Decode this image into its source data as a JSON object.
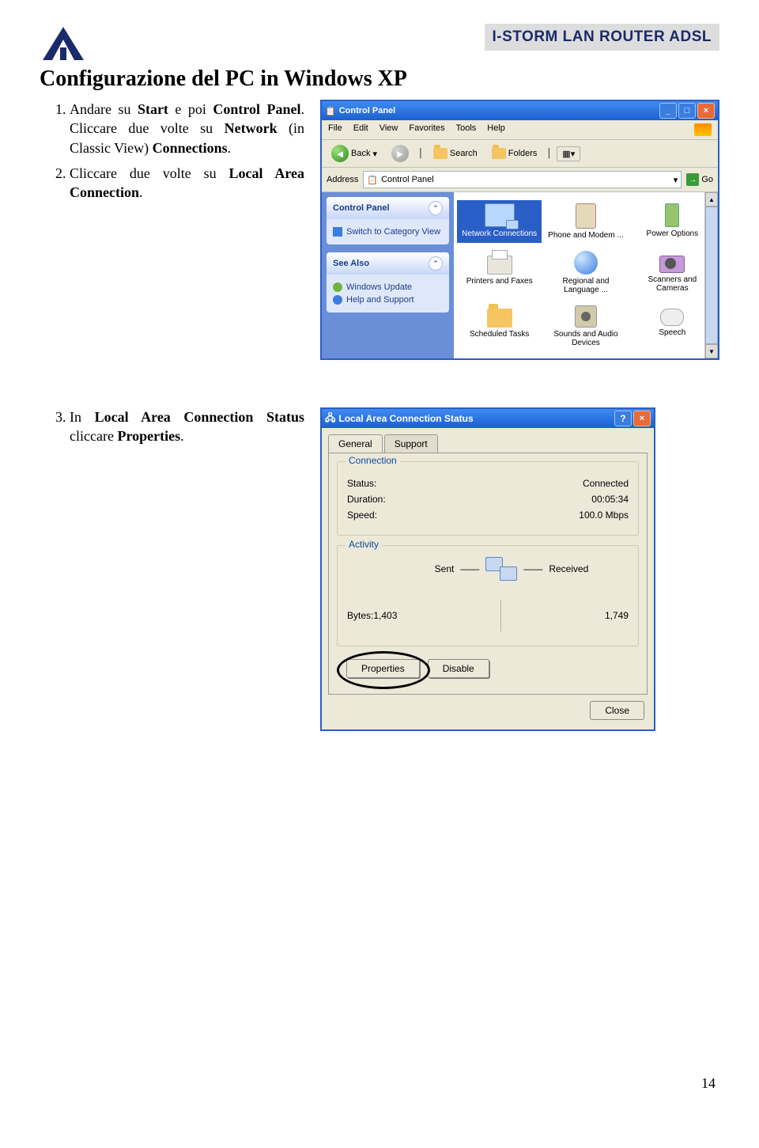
{
  "doc": {
    "header": "I-STORM LAN ROUTER ADSL",
    "title": "Configurazione del  PC in Windows XP",
    "page_number": "14"
  },
  "steps": {
    "s1a": "Andare su ",
    "s1b": "Start",
    "s1c": " e poi ",
    "s1d": "Control Panel",
    "s1e": ". Cliccare due volte su ",
    "s1f": "Network",
    "s1g": " (in Classic View) ",
    "s1h": "Connections",
    "s1i": ".",
    "s2a": "Cliccare due volte su  ",
    "s2b": "Local Area Connection",
    "s2c": ".",
    "s3a": "In ",
    "s3b": "Local Area Connection Status",
    "s3c": " cliccare ",
    "s3d": "Properties",
    "s3e": "."
  },
  "cp": {
    "title": "Control Panel",
    "menu": {
      "file": "File",
      "edit": "Edit",
      "view": "View",
      "fav": "Favorites",
      "tools": "Tools",
      "help": "Help"
    },
    "toolbar": {
      "back": "Back",
      "search": "Search",
      "folders": "Folders"
    },
    "address_label": "Address",
    "address_value": "Control Panel",
    "go": "Go",
    "panel1": {
      "title": "Control Panel",
      "link": "Switch to Category View"
    },
    "panel2": {
      "title": "See Also",
      "link1": "Windows Update",
      "link2": "Help and Support"
    },
    "icons": {
      "i0": "Network Connections",
      "i1": "Phone and Modem ...",
      "i2": "Power Options",
      "i3": "Printers and Faxes",
      "i4": "Regional and Language ...",
      "i5": "Scanners and Cameras",
      "i6": "Scheduled Tasks",
      "i7": "Sounds and Audio Devices",
      "i8": "Speech"
    }
  },
  "status": {
    "title": "Local Area Connection Status",
    "tab_general": "General",
    "tab_support": "Support",
    "group_conn": "Connection",
    "k_status": "Status:",
    "v_status": "Connected",
    "k_dur": "Duration:",
    "v_dur": "00:05:34",
    "k_speed": "Speed:",
    "v_speed": "100.0 Mbps",
    "group_act": "Activity",
    "sent": "Sent",
    "received": "Received",
    "k_bytes": "Bytes:",
    "v_sent": "1,403",
    "v_recv": "1,749",
    "btn_props": "Properties",
    "btn_disable": "Disable",
    "btn_close": "Close"
  }
}
